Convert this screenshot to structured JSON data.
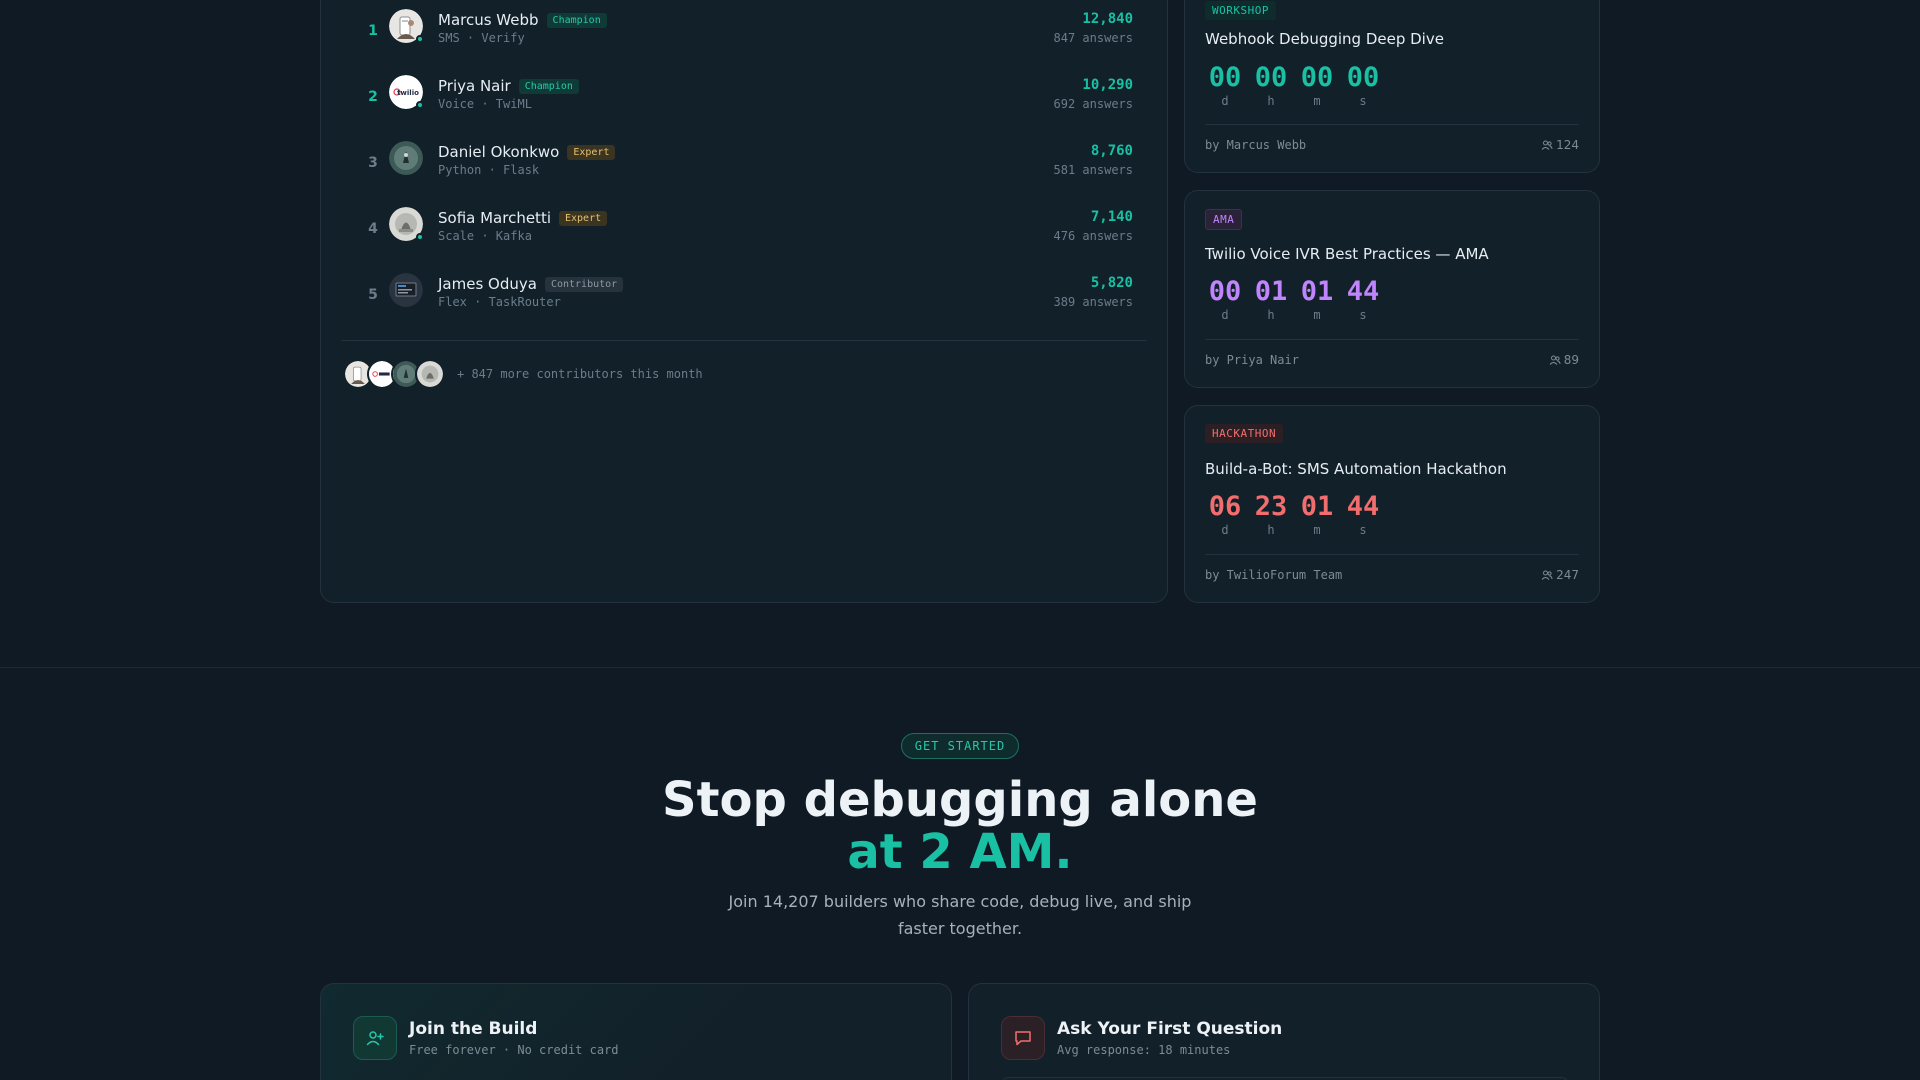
{
  "leaderboard": {
    "rows": [
      {
        "rank": "1",
        "name": "Marcus Webb",
        "badge": "Champion",
        "tags": "SMS · Verify",
        "score": "12,840",
        "answers": "847 answers"
      },
      {
        "rank": "2",
        "name": "Priya Nair",
        "badge": "Champion",
        "tags": "Voice · TwiML",
        "score": "10,290",
        "answers": "692 answers"
      },
      {
        "rank": "3",
        "name": "Daniel Okonkwo",
        "badge": "Expert",
        "tags": "Python · Flask",
        "score": "8,760",
        "answers": "581 answers"
      },
      {
        "rank": "4",
        "name": "Sofia Marchetti",
        "badge": "Expert",
        "tags": "Scale · Kafka",
        "score": "7,140",
        "answers": "476 answers"
      },
      {
        "rank": "5",
        "name": "James Oduya",
        "badge": "Contributor",
        "tags": "Flex · TaskRouter",
        "score": "5,820",
        "answers": "389 answers"
      }
    ],
    "avatar_logo_text": "twilio",
    "more_contributors": "+ 847 more contributors this month"
  },
  "events": [
    {
      "tag": "WORKSHOP",
      "title": "Webhook Debugging Deep Dive",
      "countdown": {
        "d": "00",
        "h": "00",
        "m": "00",
        "s": "00"
      },
      "host": "by Marcus Webb",
      "attendees": "124",
      "color": "#19c0a4"
    },
    {
      "tag": "AMA",
      "title": "Twilio Voice IVR Best Practices — AMA",
      "countdown": {
        "d": "00",
        "h": "01",
        "m": "01",
        "s": "44"
      },
      "host": "by Priya Nair",
      "attendees": "89",
      "color": "#c084fc"
    },
    {
      "tag": "HACKATHON",
      "title": "Build-a-Bot: SMS Automation Hackathon",
      "countdown": {
        "d": "06",
        "h": "23",
        "m": "01",
        "s": "44"
      },
      "host": "by TwilioForum Team",
      "attendees": "247",
      "color": "#f26d6d"
    }
  ],
  "countdown_labels": {
    "d": "d",
    "h": "h",
    "m": "m",
    "s": "s"
  },
  "cta": {
    "pill": "GET STARTED",
    "title": "Stop debugging alone",
    "title_accent": "at 2 AM.",
    "subtitle": "Join 14,207 builders who share code, debug live, and ship faster together."
  },
  "cards": {
    "join": {
      "title": "Join the Build",
      "subtitle": "Free forever · No credit card"
    },
    "ask": {
      "title": "Ask Your First Question",
      "subtitle": "Avg response: 18 minutes"
    }
  },
  "colors": {
    "accent": "#19c0a4",
    "background": "#0f1a24",
    "card": "#122029"
  }
}
